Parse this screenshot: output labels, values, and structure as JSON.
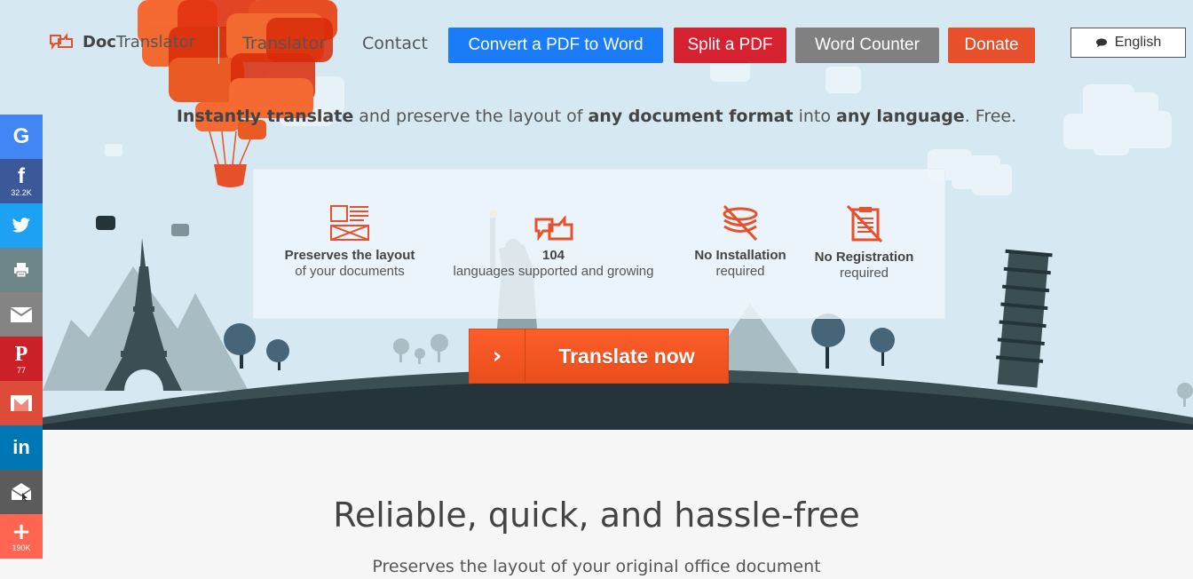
{
  "header": {
    "logo_bold": "Doc",
    "logo_rest": "Translator",
    "nav": [
      {
        "label": "Translator"
      },
      {
        "label": "Contact"
      }
    ],
    "buttons": [
      {
        "label": "Convert a PDF to Word",
        "color": "#1a7cf9"
      },
      {
        "label": "Split a PDF",
        "color": "#d62130"
      },
      {
        "label": "Word Counter",
        "color": "#808080"
      },
      {
        "label": "Donate",
        "color": "#e7502a"
      }
    ],
    "language": {
      "label": "English",
      "icon": "speech-bubble-icon"
    }
  },
  "tagline": {
    "parts": [
      {
        "text": "Instantly translate",
        "bold": true
      },
      {
        "text": " and preserve the layout of ",
        "bold": false
      },
      {
        "text": "any document format",
        "bold": true
      },
      {
        "text": " into ",
        "bold": false
      },
      {
        "text": "any language",
        "bold": true
      },
      {
        "text": ". Free.",
        "bold": false
      }
    ]
  },
  "features": [
    {
      "title": "Preserves the layout",
      "subtitle": "of your documents",
      "icon": "layout-icon"
    },
    {
      "title": "104",
      "subtitle": "languages supported and growing",
      "icon": "translate-bubbles-icon"
    },
    {
      "title": "No Installation",
      "subtitle": "required",
      "icon": "no-install-icon"
    },
    {
      "title": "No Registration",
      "subtitle": "required",
      "icon": "no-registration-icon"
    }
  ],
  "cta": {
    "label": "Translate now",
    "arrow": "›"
  },
  "social": [
    {
      "name": "google",
      "icon": "G",
      "count": ""
    },
    {
      "name": "facebook",
      "icon": "f",
      "count": "32.2K"
    },
    {
      "name": "twitter",
      "icon": "twitter-bird",
      "count": ""
    },
    {
      "name": "print",
      "icon": "printer",
      "count": ""
    },
    {
      "name": "email",
      "icon": "envelope",
      "count": ""
    },
    {
      "name": "pinterest",
      "icon": "P",
      "count": "77"
    },
    {
      "name": "gmail",
      "icon": "M",
      "count": ""
    },
    {
      "name": "linkedin",
      "icon": "in",
      "count": ""
    },
    {
      "name": "mail-client",
      "icon": "open-envelope",
      "count": ""
    },
    {
      "name": "more",
      "icon": "+",
      "count": "190K"
    }
  ],
  "section": {
    "title": "Reliable, quick, and hassle-free",
    "subtitle": "Preserves the layout of your original office document"
  }
}
